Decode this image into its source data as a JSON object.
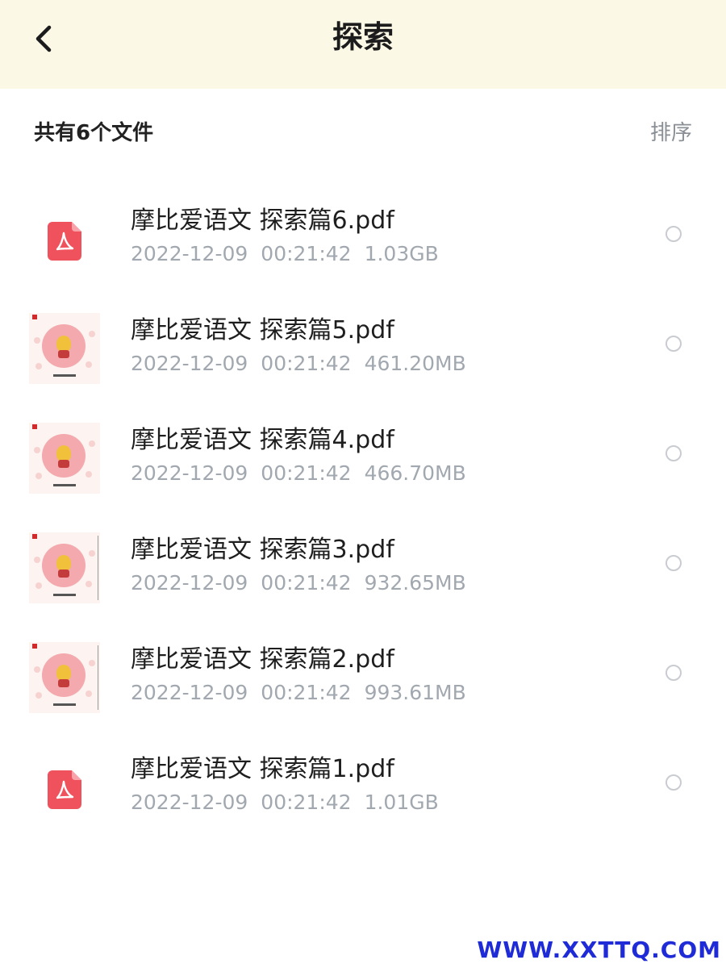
{
  "header": {
    "title": "探索"
  },
  "list_header": {
    "count_label": "共有6个文件",
    "sort_label": "排序"
  },
  "files": [
    {
      "name": "摩比爱语文 探索篇6.pdf",
      "date": "2022-12-09",
      "time": "00:21:42",
      "size": "1.03GB",
      "thumbnail": "pdf-icon"
    },
    {
      "name": "摩比爱语文 探索篇5.pdf",
      "date": "2022-12-09",
      "time": "00:21:42",
      "size": "461.20MB",
      "thumbnail": "book-cover"
    },
    {
      "name": "摩比爱语文 探索篇4.pdf",
      "date": "2022-12-09",
      "time": "00:21:42",
      "size": "466.70MB",
      "thumbnail": "book-cover"
    },
    {
      "name": "摩比爱语文 探索篇3.pdf",
      "date": "2022-12-09",
      "time": "00:21:42",
      "size": "932.65MB",
      "thumbnail": "book-cover"
    },
    {
      "name": "摩比爱语文 探索篇2.pdf",
      "date": "2022-12-09",
      "time": "00:21:42",
      "size": "993.61MB",
      "thumbnail": "book-cover"
    },
    {
      "name": "摩比爱语文 探索篇1.pdf",
      "date": "2022-12-09",
      "time": "00:21:42",
      "size": "1.01GB",
      "thumbnail": "pdf-icon"
    }
  ],
  "watermark": "WWW.XXTTQ.COM",
  "colors": {
    "header_bg": "#fcf8e6",
    "pdf_red": "#f0525d",
    "watermark": "#1f2bd6"
  }
}
